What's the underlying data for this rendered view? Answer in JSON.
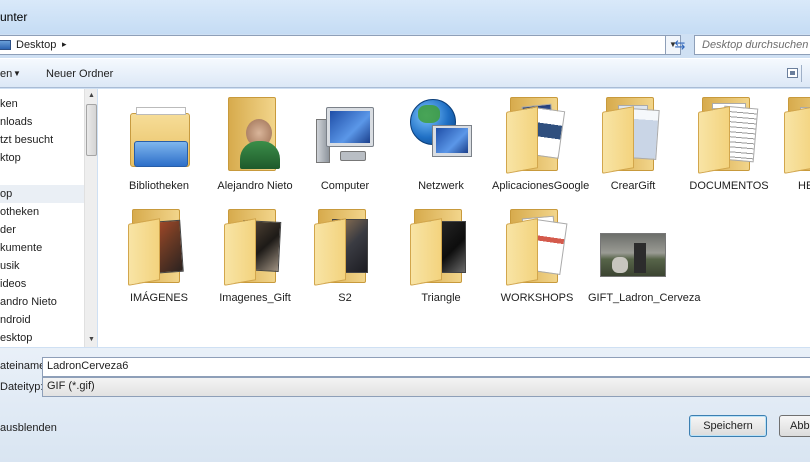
{
  "window": {
    "title": "unter"
  },
  "address": {
    "location": "Desktop",
    "breadcrumb_arrow": "▸"
  },
  "search": {
    "placeholder": "Desktop durchsuchen"
  },
  "toolbar": {
    "organize_label": "en",
    "organize_arrow": "▼",
    "new_folder_label": "Neuer Ordner"
  },
  "nav": {
    "items": [
      {
        "label": "ken"
      },
      {
        "label": "nloads"
      },
      {
        "label": "tzt besucht"
      },
      {
        "label": "ktop"
      },
      {
        "label": "op",
        "selected": true
      },
      {
        "label": "otheken"
      },
      {
        "label": "der"
      },
      {
        "label": "kumente"
      },
      {
        "label": "usik"
      },
      {
        "label": "ideos"
      },
      {
        "label": "andro Nieto"
      },
      {
        "label": "ndroid"
      },
      {
        "label": "esktop"
      }
    ],
    "scroll_up": "▲",
    "scroll_down": "▼"
  },
  "files": [
    {
      "label": "Bibliotheken",
      "icon": "library-folder-icon"
    },
    {
      "label": "Alejandro Nieto",
      "icon": "user-folder-icon"
    },
    {
      "label": "Computer",
      "icon": "computer-icon"
    },
    {
      "label": "Netzwerk",
      "icon": "network-icon"
    },
    {
      "label": "AplicacionesGoogle",
      "icon": "folder-documents-icon"
    },
    {
      "label": "CrearGift",
      "icon": "folder-documents-icon"
    },
    {
      "label": "DOCUMENTOS",
      "icon": "folder-documents-icon"
    },
    {
      "label": "HE",
      "icon": "folder-documents-icon"
    },
    {
      "label": "IMÁGENES",
      "icon": "folder-photos-icon"
    },
    {
      "label": "Imagenes_Gift",
      "icon": "folder-photos-icon"
    },
    {
      "label": "S2",
      "icon": "folder-photos-icon"
    },
    {
      "label": "Triangle",
      "icon": "folder-photos-icon"
    },
    {
      "label": "WORKSHOPS",
      "icon": "folder-documents-icon"
    },
    {
      "label": "GIFT_Ladron_Cerveza",
      "icon": "gif-thumbnail-icon"
    }
  ],
  "bottom": {
    "filename_label": "ateiname:",
    "filename_value": "LadronCerveza6",
    "filetype_label": "Dateityp:",
    "filetype_value": "GIF (*.gif)",
    "hide_folders_label": "ausblenden",
    "save_label": "Speichern",
    "cancel_label": "Abb"
  },
  "colors": {
    "selection": "#eaeff5",
    "accent_border": "#3c7fb1"
  }
}
